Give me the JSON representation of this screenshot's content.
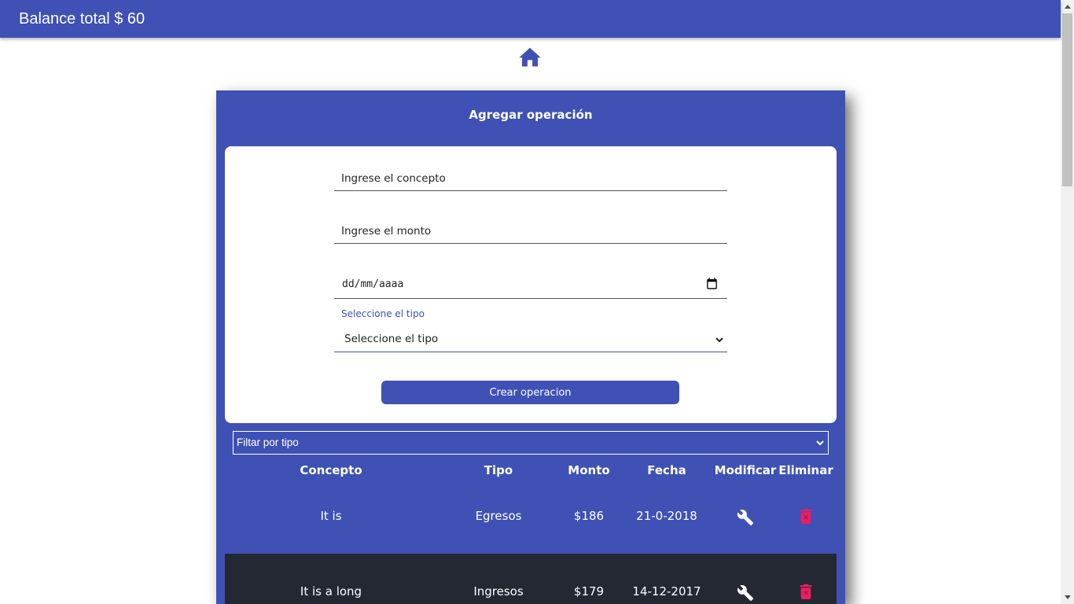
{
  "header": {
    "title": "Balance total $ 60"
  },
  "home": {
    "icon": "home-icon"
  },
  "card": {
    "title": "Agregar operación"
  },
  "form": {
    "concept_placeholder": "Ingrese el concepto",
    "amount_placeholder": "Ingrese el monto",
    "date_placeholder": "dd/mm/aaaa",
    "type_label": "Seleccione el tipo",
    "type_value": "Seleccione el tipo",
    "submit_label": "Crear operacion"
  },
  "filter": {
    "value": "Filtar por tipo"
  },
  "table": {
    "headers": [
      "Concepto",
      "Tipo",
      "Monto",
      "Fecha",
      "Modificar",
      "Eliminar"
    ],
    "rows": [
      {
        "concepto": "It is",
        "tipo": "Egresos",
        "monto": "$186",
        "fecha": "21-0-2018"
      },
      {
        "concepto": "It is a long",
        "tipo": "Ingresos",
        "monto": "$179",
        "fecha": "14-12-2017"
      }
    ]
  },
  "colors": {
    "primary": "#3f51b5",
    "dark_row": "#242833",
    "delete": "#e91e63"
  },
  "icons": {
    "modify": "wrench-icon",
    "delete": "trash-icon",
    "calendar": "calendar-icon",
    "dropdown": "chevron-down-icon"
  }
}
